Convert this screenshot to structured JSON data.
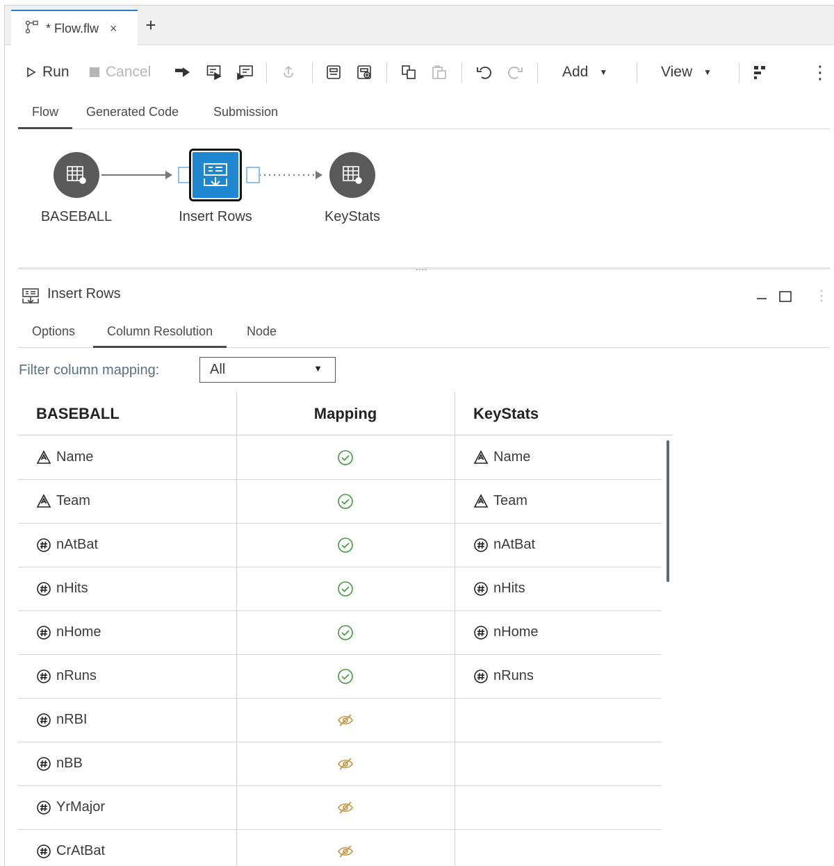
{
  "document_tab": {
    "label": "* Flow.flw",
    "close": "×",
    "add": "+"
  },
  "toolbar": {
    "run": "Run",
    "cancel": "Cancel",
    "add": "Add",
    "view": "View",
    "caret": "▼",
    "more": "⋮"
  },
  "view_tabs": [
    {
      "label": "Flow",
      "active": true
    },
    {
      "label": "Generated Code"
    },
    {
      "label": "Submission"
    }
  ],
  "flow": {
    "nodes": [
      {
        "label": "BASEBALL",
        "type": "table"
      },
      {
        "label": "Insert Rows",
        "type": "step",
        "selected": true
      },
      {
        "label": "KeyStats",
        "type": "table"
      }
    ],
    "grip": "...."
  },
  "panel": {
    "title": "Insert Rows",
    "tabs": [
      {
        "label": "Options"
      },
      {
        "label": "Column Resolution",
        "active": true
      },
      {
        "label": "Node"
      }
    ],
    "filter_label": "Filter column mapping:",
    "filter_value": "All",
    "filter_caret": "▼"
  },
  "table": {
    "headers": {
      "source": "BASEBALL",
      "mapping": "Mapping",
      "target": "KeyStats"
    },
    "rows": [
      {
        "source": "Name",
        "source_type": "character",
        "mapping": "mapped",
        "target": "Name",
        "target_type": "character"
      },
      {
        "source": "Team",
        "source_type": "character",
        "mapping": "mapped",
        "target": "Team",
        "target_type": "character"
      },
      {
        "source": "nAtBat",
        "source_type": "numeric",
        "mapping": "mapped",
        "target": "nAtBat",
        "target_type": "numeric"
      },
      {
        "source": "nHits",
        "source_type": "numeric",
        "mapping": "mapped",
        "target": "nHits",
        "target_type": "numeric"
      },
      {
        "source": "nHome",
        "source_type": "numeric",
        "mapping": "mapped",
        "target": "nHome",
        "target_type": "numeric"
      },
      {
        "source": "nRuns",
        "source_type": "numeric",
        "mapping": "mapped",
        "target": "nRuns",
        "target_type": "numeric"
      },
      {
        "source": "nRBI",
        "source_type": "numeric",
        "mapping": "unmapped",
        "target": "",
        "target_type": ""
      },
      {
        "source": "nBB",
        "source_type": "numeric",
        "mapping": "unmapped",
        "target": "",
        "target_type": ""
      },
      {
        "source": "YrMajor",
        "source_type": "numeric",
        "mapping": "unmapped",
        "target": "",
        "target_type": ""
      },
      {
        "source": "CrAtBat",
        "source_type": "numeric",
        "mapping": "unmapped",
        "target": "",
        "target_type": ""
      }
    ]
  },
  "colors": {
    "accent": "#1f87d0",
    "mapped": "#3f9a3a",
    "unmapped": "#c5913c",
    "node": "#5a5a5a"
  },
  "icons": {
    "flow_tab": "flow-icon",
    "character": "character-column-icon",
    "numeric": "numeric-column-icon",
    "mapped": "check-circle-icon",
    "unmapped": "hidden-eye-icon"
  }
}
